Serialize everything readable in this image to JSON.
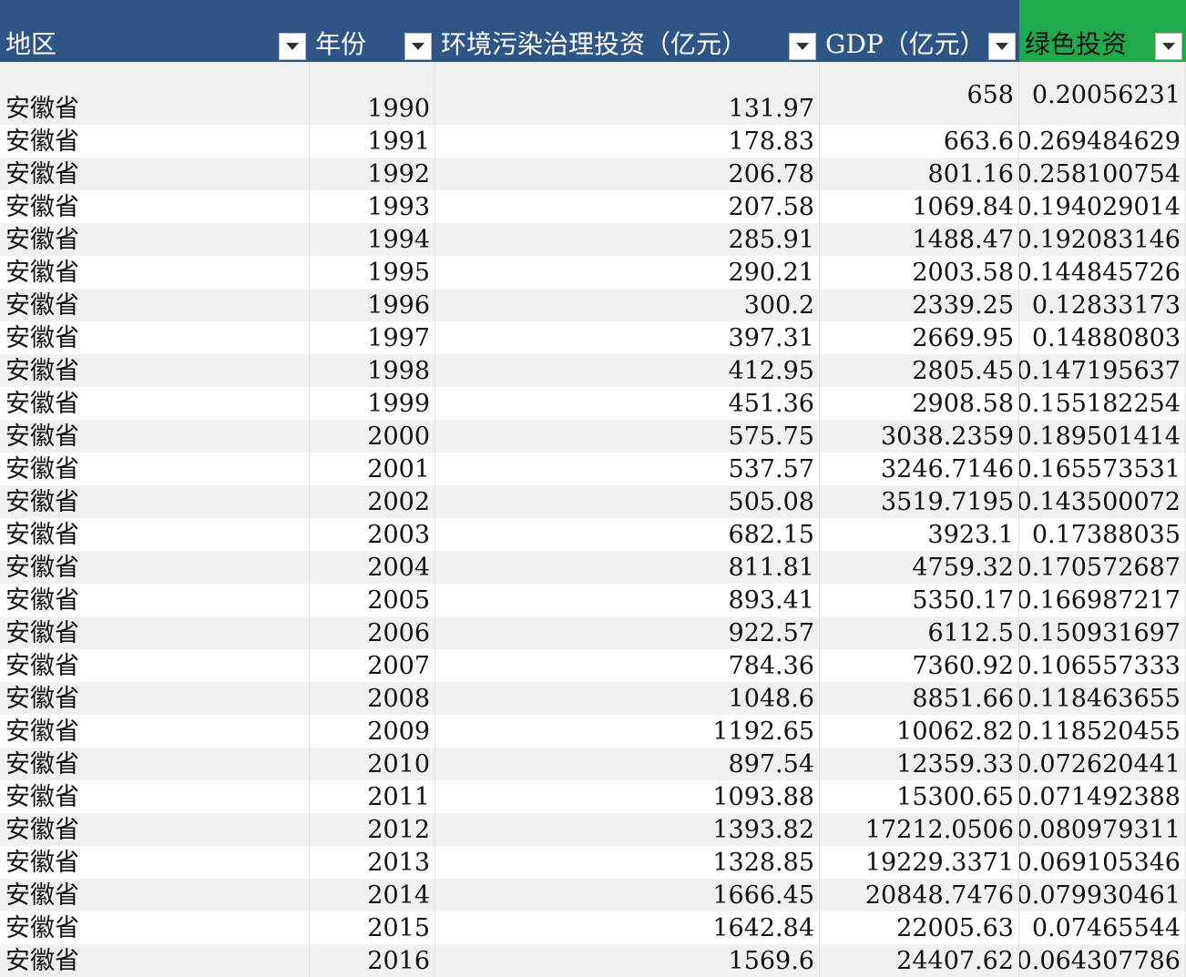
{
  "table": {
    "headers": [
      {
        "label": "地区",
        "filter_icon": "filter-dropdown-icon",
        "bg": "#2f5587"
      },
      {
        "label": "年份",
        "filter_icon": "filter-dropdown-icon",
        "bg": "#2f5587"
      },
      {
        "label": "环境污染治理投资（亿元）",
        "filter_icon": "filter-dropdown-icon",
        "bg": "#2f5587"
      },
      {
        "label": "GDP（亿元）",
        "filter_icon": "filter-dropdown-icon",
        "bg": "#2f5587"
      },
      {
        "label": "绿色投资",
        "filter_icon": "filter-dropdown-icon",
        "bg": "#1faa4b"
      }
    ],
    "rows": [
      [
        "安徽省",
        "1990",
        "131.97",
        "658",
        "0.20056231"
      ],
      [
        "安徽省",
        "1991",
        "178.83",
        "663.6",
        "0.269484629"
      ],
      [
        "安徽省",
        "1992",
        "206.78",
        "801.16",
        "0.258100754"
      ],
      [
        "安徽省",
        "1993",
        "207.58",
        "1069.84",
        "0.194029014"
      ],
      [
        "安徽省",
        "1994",
        "285.91",
        "1488.47",
        "0.192083146"
      ],
      [
        "安徽省",
        "1995",
        "290.21",
        "2003.58",
        "0.144845726"
      ],
      [
        "安徽省",
        "1996",
        "300.2",
        "2339.25",
        "0.12833173"
      ],
      [
        "安徽省",
        "1997",
        "397.31",
        "2669.95",
        "0.14880803"
      ],
      [
        "安徽省",
        "1998",
        "412.95",
        "2805.45",
        "0.147195637"
      ],
      [
        "安徽省",
        "1999",
        "451.36",
        "2908.58",
        "0.155182254"
      ],
      [
        "安徽省",
        "2000",
        "575.75",
        "3038.2359",
        "0.189501414"
      ],
      [
        "安徽省",
        "2001",
        "537.57",
        "3246.7146",
        "0.165573531"
      ],
      [
        "安徽省",
        "2002",
        "505.08",
        "3519.7195",
        "0.143500072"
      ],
      [
        "安徽省",
        "2003",
        "682.15",
        "3923.1",
        "0.17388035"
      ],
      [
        "安徽省",
        "2004",
        "811.81",
        "4759.32",
        "0.170572687"
      ],
      [
        "安徽省",
        "2005",
        "893.41",
        "5350.17",
        "0.166987217"
      ],
      [
        "安徽省",
        "2006",
        "922.57",
        "6112.5",
        "0.150931697"
      ],
      [
        "安徽省",
        "2007",
        "784.36",
        "7360.92",
        "0.106557333"
      ],
      [
        "安徽省",
        "2008",
        "1048.6",
        "8851.66",
        "0.118463655"
      ],
      [
        "安徽省",
        "2009",
        "1192.65",
        "10062.82",
        "0.118520455"
      ],
      [
        "安徽省",
        "2010",
        "897.54",
        "12359.33",
        "0.072620441"
      ],
      [
        "安徽省",
        "2011",
        "1093.88",
        "15300.65",
        "0.071492388"
      ],
      [
        "安徽省",
        "2012",
        "1393.82",
        "17212.0506",
        "0.080979311"
      ],
      [
        "安徽省",
        "2013",
        "1328.85",
        "19229.3371",
        "0.069105346"
      ],
      [
        "安徽省",
        "2014",
        "1666.45",
        "20848.7476",
        "0.079930461"
      ],
      [
        "安徽省",
        "2015",
        "1642.84",
        "22005.63",
        "0.07465544"
      ],
      [
        "安徽省",
        "2016",
        "1569.6",
        "24407.62",
        "0.064307786"
      ]
    ]
  }
}
